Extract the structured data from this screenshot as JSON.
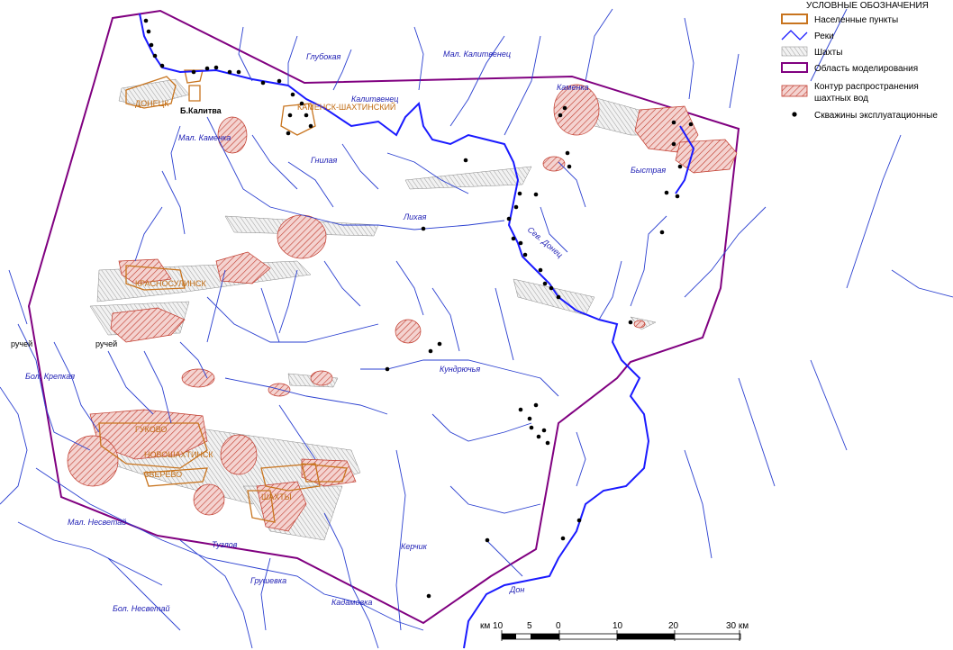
{
  "colors": {
    "river": "#1a1aff",
    "river_thin": "#2a3fd0",
    "settlement": "#c8741e",
    "boundary": "#800080",
    "mine_water": "#c0392b",
    "mine": "#9a9a9a",
    "well": "#000000"
  },
  "legend": {
    "title": "УСЛОВНЫЕ ОБОЗНАЧЕНИЯ",
    "items": [
      {
        "key": "settlement",
        "label": "Населенные пункты",
        "icon": "orange-outline-rect-icon"
      },
      {
        "key": "river",
        "label": "Реки",
        "icon": "river-line-icon"
      },
      {
        "key": "mine",
        "label": "Шахты",
        "icon": "hatched-gray-icon"
      },
      {
        "key": "boundary",
        "label": "Область моделирования",
        "icon": "purple-outline-rect-icon"
      },
      {
        "key": "mine_water",
        "label": "Контур распространения",
        "label2": "шахтных вод",
        "icon": "red-hatched-icon"
      },
      {
        "key": "well",
        "label": "Скважины эксплуатационные",
        "icon": "black-dot-icon"
      }
    ]
  },
  "river_labels": {
    "glubokaya": "Глубокая",
    "mal_kalitvenets": "Мал. Калитвенец",
    "kalitvenets": "Калитвенец",
    "mal_kamenka": "Мал. Каменка",
    "gnilaya": "Гнилая",
    "kamenka": "Каменка",
    "bystraya": "Быстрая",
    "likhaya": "Лихая",
    "sev_donets": "Сев. Донец",
    "rucheiA": "ручей",
    "rucheiB": "ручей",
    "bol_krepkaya": "Бол. Крепкая",
    "kundryuchya": "Кундрючья",
    "mal_nesvetai": "Мал. Несветай",
    "tuzlov": "Тузлов",
    "grushevka": "Грушевка",
    "kerchik": "Керчик",
    "bol_nesvetai": "Бол. Несветай",
    "kadamovka": "Кадамовка",
    "don": "Дон"
  },
  "town_labels": {
    "donetsk": "ДОНЕЦК",
    "belaya_kalitva": "Б.Калитва",
    "krasnosulinsk": "КРАСНОСУЛИНСК",
    "shakhty": "ШАХТЫ",
    "novoshakhtinsk": "НОВОШАХТИНСК",
    "gukovo": "ГУКОВО",
    "zverevo": "ЗВЕРЕВО",
    "kamensk": "КАМЕНСК-ШАХТИНСКИЙ"
  },
  "scale": {
    "left_label": "км 10",
    "ticks": [
      "5",
      "0",
      "10",
      "20",
      "30 км"
    ]
  }
}
